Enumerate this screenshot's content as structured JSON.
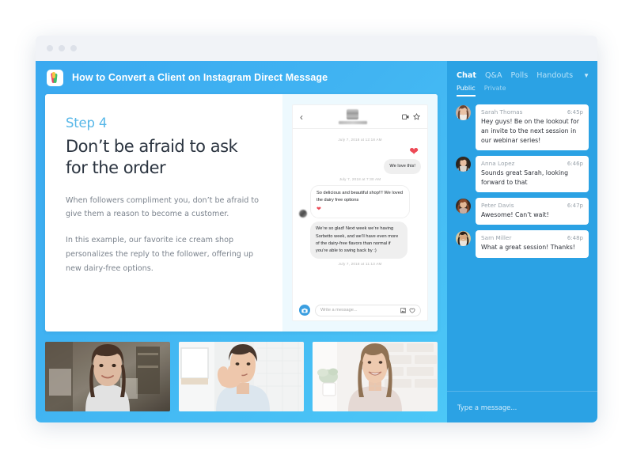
{
  "window": {
    "traffic_dots": [
      "close",
      "minimize",
      "maximize"
    ]
  },
  "webinar": {
    "title": "How to Convert a Client on Instagram Direct Message",
    "logo_name": "app-logo-icon"
  },
  "slide": {
    "step": "Step 4",
    "heading": "Don’t be afraid to ask for the order",
    "paragraph1": "When followers compliment you, don’t be afraid to give them a reason to become a customer.",
    "paragraph2": "In this example, our favorite ice cream shop personalizes the reply to the follower, offering up new dairy-free options."
  },
  "instagram": {
    "back_icon": "‹",
    "timestamp1": "July 7, 2018 at 12:18 AM",
    "timestamp2": "July 7, 2018 at 7:30 AM",
    "timestamp3": "July 7, 2018 at 11:13 AM",
    "heart": "❤",
    "message_out": "We love this!",
    "message_in": "So delicious and beautiful shop!!! We loved the dairy free options",
    "message_reply": "We’re so glad! Next week we’re having Sorbetto week, and we’ll have even more of the dairy-free flavors than normal if you’re able to swing back by :)",
    "input_placeholder": "Write a message..."
  },
  "thumbnails": [
    {
      "name": "participant-video-1"
    },
    {
      "name": "participant-video-2"
    },
    {
      "name": "participant-video-3"
    }
  ],
  "chat": {
    "tabs": [
      {
        "label": "Chat",
        "active": true
      },
      {
        "label": "Q&A",
        "active": false
      },
      {
        "label": "Polls",
        "active": false
      },
      {
        "label": "Handouts",
        "active": false
      }
    ],
    "chevron": "▼",
    "subtabs": [
      {
        "label": "Public",
        "active": true
      },
      {
        "label": "Private",
        "active": false
      }
    ],
    "messages": [
      {
        "name": "Sarah Thomas",
        "time": "6:45p",
        "text": "Hey guys! Be on the lookout for an invite to the next session in our webinar series!"
      },
      {
        "name": "Anna Lopez",
        "time": "6:46p",
        "text": "Sounds great Sarah, looking forward to that"
      },
      {
        "name": "Peter Davis",
        "time": "6:47p",
        "text": "Awesome! Can’t wait!"
      },
      {
        "name": "Sam Miller",
        "time": "6:48p",
        "text": "What a great session! Thanks!"
      }
    ],
    "input_placeholder": "Type a message..."
  },
  "colors": {
    "stage_blue_top": "#3aa9f0",
    "stage_blue_bottom": "#4cc8f7",
    "chat_panel_blue": "#2ba2e4",
    "step_label_blue": "#57b7e8",
    "heart_red": "#ed4956"
  }
}
